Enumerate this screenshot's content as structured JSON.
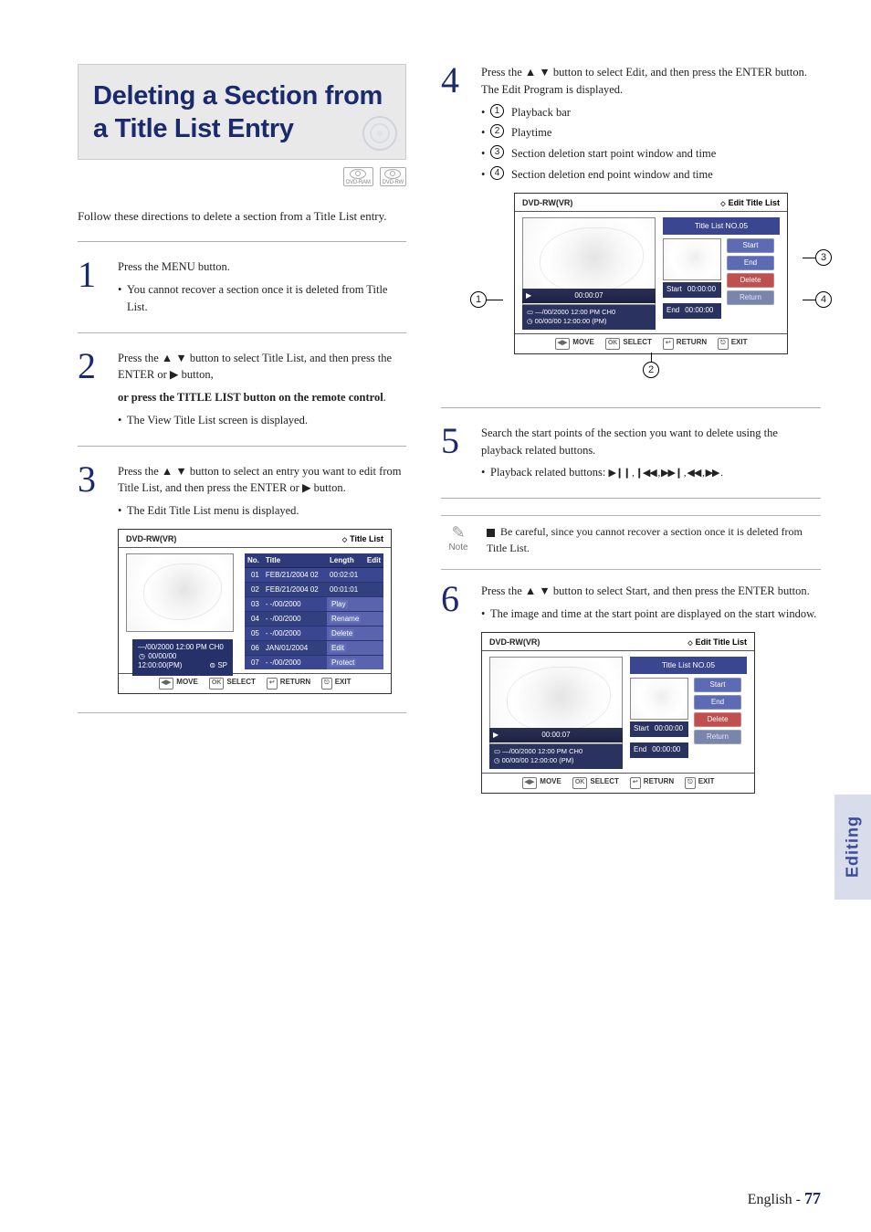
{
  "title": "Deleting a Section from a Title List Entry",
  "disc_badges": [
    "DVD-RAM",
    "DVD-RW"
  ],
  "intro": "Follow these directions to delete a section from a Title List entry.",
  "icons": {
    "up": "▲",
    "down": "▼",
    "right": "▶"
  },
  "steps": {
    "s1": {
      "num": "1",
      "p": "Press the MENU button.",
      "b1": "You cannot recover a section once it is deleted from Title List."
    },
    "s2": {
      "num": "2",
      "p": "Press the ▲ ▼ button to select Title List, and then press the ENTER or ▶ button,",
      "strong": "or press the TITLE LIST button on the remote control",
      "after_strong": ".",
      "b1": "The View Title List screen is displayed."
    },
    "s3": {
      "num": "3",
      "p": "Press the ▲ ▼ button to select an entry you want to edit from Title List, and then press the ENTER or ▶ button.",
      "b1": "The Edit Title List menu is displayed."
    },
    "s4": {
      "num": "4",
      "p": "Press the ▲ ▼ button to select Edit, and then press the ENTER button. The Edit Program is displayed.",
      "items": [
        "Playback bar",
        "Playtime",
        "Section deletion start point window and time",
        "Section deletion end point window and time"
      ]
    },
    "s5": {
      "num": "5",
      "p": "Search the start points of the section you want to delete using the playback related buttons.",
      "bullet_prefix": "Playback related buttons: ",
      "pbuttons": "▶❙❙ , ❙◀◀ , ▶▶❙ , ◀◀ , ▶▶ ."
    },
    "s6": {
      "num": "6",
      "p": "Press the ▲ ▼ button to select Start, and then press the ENTER button.",
      "b1": "The image and time at the start point are displayed on the start window."
    }
  },
  "note": {
    "label": "Note",
    "text": "Be careful, since you cannot recover a section once it is deleted from Title List."
  },
  "osd_titlelist": {
    "model": "DVD-RW(VR)",
    "title": "Title List",
    "headers": {
      "no": "No.",
      "title": "Title",
      "length": "Length",
      "edit": "Edit"
    },
    "rows": [
      {
        "no": "01",
        "title": "FEB/21/2004 02",
        "r": "00:02:01"
      },
      {
        "no": "02",
        "title": "FEB/21/2004 02",
        "r": "00:01:01"
      },
      {
        "no": "03",
        "title": "- -/00/2000",
        "r": "Play"
      },
      {
        "no": "04",
        "title": "- -/00/2000",
        "r": "Rename"
      },
      {
        "no": "05",
        "title": "- -/00/2000",
        "r": "Delete"
      },
      {
        "no": "06",
        "title": "JAN/01/2004",
        "r": "Edit"
      },
      {
        "no": "07",
        "title": "- -/00/2000",
        "r": "Protect"
      }
    ],
    "meta": {
      "line1": "—/00/2000 12:00 PM CH0",
      "line2a": "00/00/00",
      "line3a": "12:00:00(PM)",
      "line3b": "⊜ SP"
    },
    "footer": {
      "move": "MOVE",
      "select": "SELECT",
      "return": "RETURN",
      "exit": "EXIT"
    }
  },
  "osd_edit": {
    "model": "DVD-RW(VR)",
    "title": "Edit Title List",
    "tln": "Title List NO.05",
    "playtime": "00:00:07",
    "meta1": "—/00/2000 12:00 PM CH0",
    "meta2_top": "00/00/00 12:00:00 (PM)",
    "meta2_bot": "00/00/00 12:00:00 (PM)",
    "start_label": "Start",
    "end_label": "End",
    "start_time": "00:00:00",
    "end_time": "00:00:00",
    "buttons": {
      "start": "Start",
      "end": "End",
      "delete": "Delete",
      "ret": "Return"
    },
    "footer": {
      "move": "MOVE",
      "select": "SELECT",
      "return": "RETURN",
      "exit": "EXIT"
    }
  },
  "footer": {
    "lang": "English",
    "dash": " - ",
    "page": "77"
  },
  "side_tab": "Editing"
}
